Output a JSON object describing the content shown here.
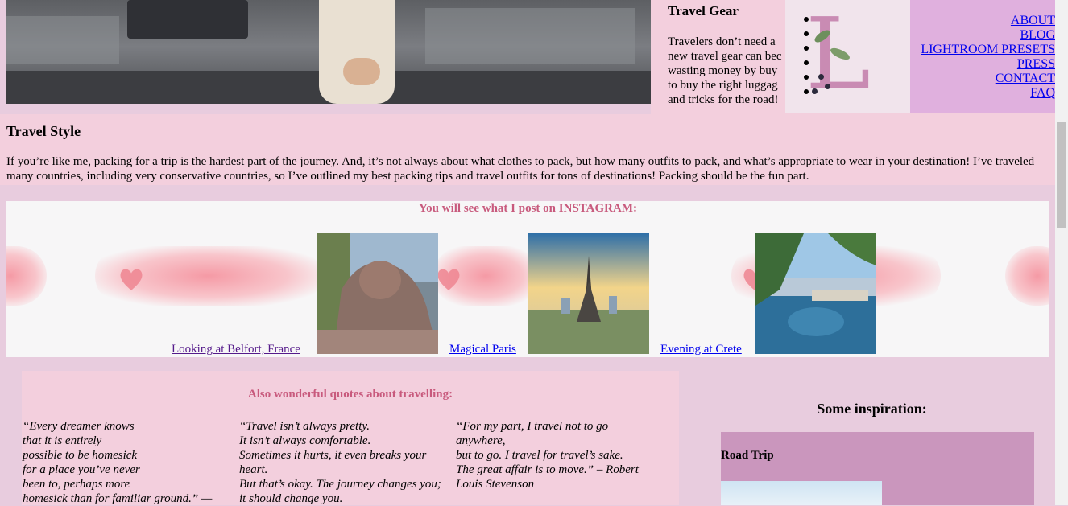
{
  "travel_gear": {
    "title": "Travel Gear",
    "lines": [
      "Travelers don’t need a",
      "new travel gear can bec",
      "wasting money by buy",
      "to buy the right luggag",
      "and tricks for the road!"
    ]
  },
  "nav": {
    "items": [
      "ABOUT",
      "BLOG",
      "LIGHTROOM PRESETS",
      "PRESS",
      "CONTACT",
      "FAQ"
    ]
  },
  "travel_style": {
    "title": "Travel Style",
    "text": "If you’re like me, packing for a trip is the hardest part of the journey. And, it’s not always about what clothes to pack, but how many outfits to pack, and what’s appropriate to wear in your destination! I’ve traveled many countries, including very conservative countries, so I’ve outlined my best packing tips and travel outfits for tons of destinations! Packing should be the fun part."
  },
  "instagram": {
    "heading": "You will see what I post on INSTAGRAM:",
    "posts": [
      {
        "label": "Looking at Belfort, France"
      },
      {
        "label": "Magical Paris"
      },
      {
        "label": "Evening at Crete"
      }
    ]
  },
  "quotes": {
    "heading": "Also wonderful quotes about travelling:",
    "items": [
      "“Every dreamer knows\nthat it is entirely\npossible to be homesick\nfor a place you’ve never\nbeen to, perhaps more\nhomesick than for familiar ground.” —",
      "“Travel isn’t always pretty.\nIt isn’t always comfortable.\nSometimes it hurts, it even breaks your\nheart.\nBut that’s okay. The journey changes you;\nit should change you.",
      "“For my part, I travel not to go\nanywhere,\nbut to go. I travel for travel’s sake.\nThe great affair is to move.” – Robert\nLouis Stevenson"
    ]
  },
  "inspiration": {
    "title": "Some inspiration:",
    "card_label": "Road Trip"
  },
  "colors": {
    "pink_bg": "#f3cfdd",
    "page_bg": "#e8ccde",
    "nav_bg": "#e0b0de",
    "accent_heading": "#c85a7d",
    "card_bg": "#ca96bd"
  }
}
